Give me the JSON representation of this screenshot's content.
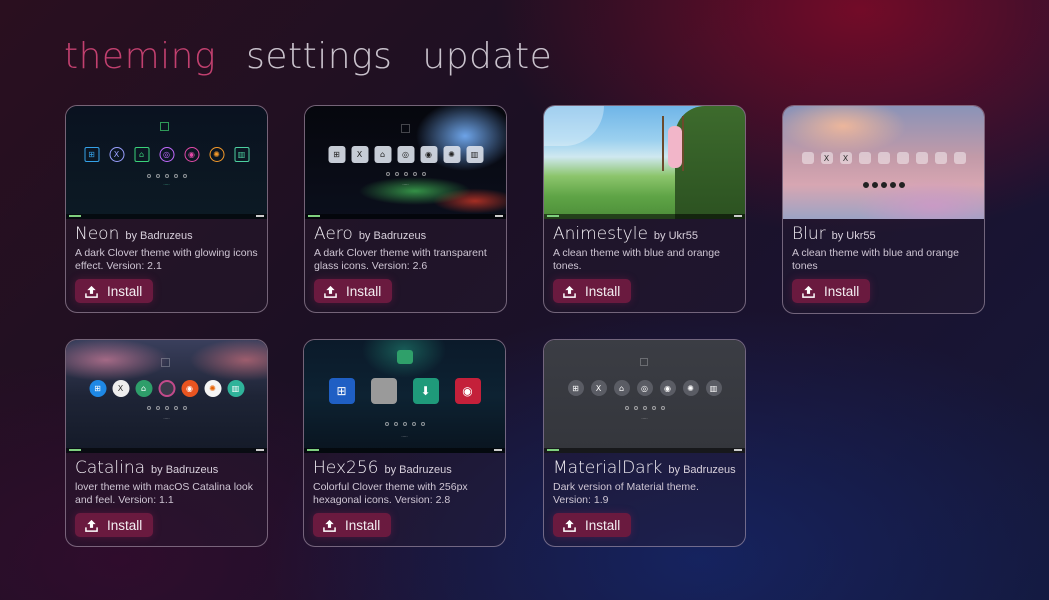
{
  "tabs": [
    {
      "label": "theming",
      "active": true
    },
    {
      "label": "settings",
      "active": false
    },
    {
      "label": "update",
      "active": false
    }
  ],
  "install_label": "Install",
  "accent_color": "#c2406f",
  "button_color": "#6a1a3f",
  "themes": [
    {
      "name": "Neon",
      "author": "by Badruzeus",
      "description": "A dark Clover theme with glowing icons effect. Version: 2.1"
    },
    {
      "name": "Aero",
      "author": "by Badruzeus",
      "description": "A dark Clover theme with transparent glass icons. Version: 2.6"
    },
    {
      "name": "Animestyle",
      "author": "by Ukr55",
      "description": "A clean theme with blue and orange tones."
    },
    {
      "name": "Blur",
      "author": "by Ukr55",
      "description": "A clean theme with blue and orange tones"
    },
    {
      "name": "Catalina",
      "author": "by Badruzeus",
      "description": "lover theme with macOS Catalina look and feel. Version: 1.1"
    },
    {
      "name": "Hex256",
      "author": "by Badruzeus",
      "description": "Colorful Clover theme with 256px hexagonal icons. Version: 2.8"
    },
    {
      "name": "MaterialDark",
      "author": "by Badruzeus",
      "description": "Dark version of Material theme. Version: 1.9"
    }
  ]
}
